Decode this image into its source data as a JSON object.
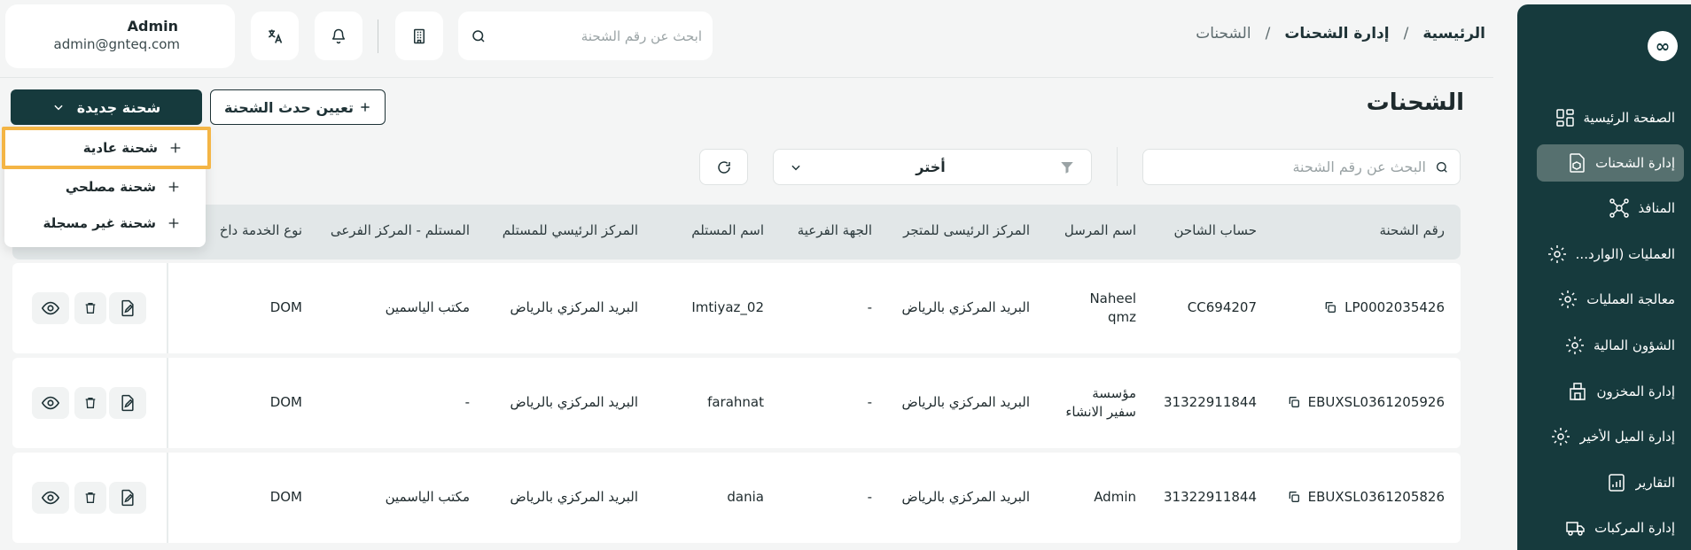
{
  "sidebar": {
    "logo_text": "∞",
    "items": [
      {
        "label": "الصفحة الرئيسية",
        "icon": "dashboard-icon",
        "active": false
      },
      {
        "label": "إدارة الشحنات",
        "icon": "package-icon",
        "active": true
      },
      {
        "label": "المنافذ",
        "icon": "network-icon",
        "active": false
      },
      {
        "label": "العمليات (الوارد...",
        "icon": "gear-icon",
        "active": false
      },
      {
        "label": "معالجة العمليات",
        "icon": "gear-icon",
        "active": false
      },
      {
        "label": "الشؤون المالية",
        "icon": "gear-icon",
        "active": false
      },
      {
        "label": "إدارة المخزون",
        "icon": "warehouse-icon",
        "active": false
      },
      {
        "label": "إدارة الميل الأخير",
        "icon": "gear-icon",
        "active": false
      },
      {
        "label": "التقارير",
        "icon": "report-icon",
        "active": false
      },
      {
        "label": "إدارة المركبات",
        "icon": "truck-icon",
        "active": false
      }
    ]
  },
  "breadcrumb": {
    "home": "الرئيسية",
    "section": "إدارة الشحنات",
    "current": "الشحنات",
    "separator": "/"
  },
  "header": {
    "search_placeholder": "ابحث عن رقم الشحنة",
    "user_name": "Admin",
    "user_email": "admin@gnteq.com"
  },
  "page": {
    "title": "الشحنات",
    "new_shipment_label": "شحنة جديدة",
    "assign_event_label": "تعيين حدث الشحنة"
  },
  "dropdown": {
    "items": [
      "شحنة عادية",
      "شحنة مصلحي",
      "شحنة غير مسجلة"
    ]
  },
  "filters": {
    "search_placeholder": "البحث عن رقم الشحنة",
    "select_value": "أختر"
  },
  "table": {
    "headers": [
      "رقم الشحنة",
      "حساب الشاحن",
      "اسم المرسل",
      "المركز الرئيسى للمتجر",
      "الجهة الفرعية",
      "اسم المستلم",
      "المركز الرئيسي للمستلم",
      "المستلم - المركز الفرعى",
      "نوع الخدمة داخ"
    ],
    "rows": [
      {
        "shipment_no": "LP0002035426",
        "shipper_account": "CC694207",
        "sender_line1": "Naheel",
        "sender_line2": "qmz",
        "store_center": "البريد المركزي بالرياض",
        "sub_entity": "-",
        "receiver": "Imtiyaz_02",
        "receiver_center": "البريد المركزي بالرياض",
        "receiver_sub": "مكتب الياسمين",
        "service_type": "DOM"
      },
      {
        "shipment_no": "EBUXSL0361205926",
        "shipper_account": "31322911844",
        "sender_line1": "مؤسسة",
        "sender_line2": "سفير الانشاء",
        "store_center": "البريد المركزي بالرياض",
        "sub_entity": "-",
        "receiver": "farahnat",
        "receiver_center": "البريد المركزي بالرياض",
        "receiver_sub": "-",
        "service_type": "DOM"
      },
      {
        "shipment_no": "EBUXSL0361205826",
        "shipper_account": "31322911844",
        "sender_line1": "Admin",
        "sender_line2": "",
        "store_center": "البريد المركزي بالرياض",
        "sub_entity": "-",
        "receiver": "dania",
        "receiver_center": "البريد المركزي بالرياض",
        "receiver_sub": "مكتب الياسمين",
        "service_type": "DOM"
      }
    ]
  },
  "colors": {
    "primary": "#163a3d",
    "highlight": "#f4b545",
    "active_item": "#56706f"
  }
}
